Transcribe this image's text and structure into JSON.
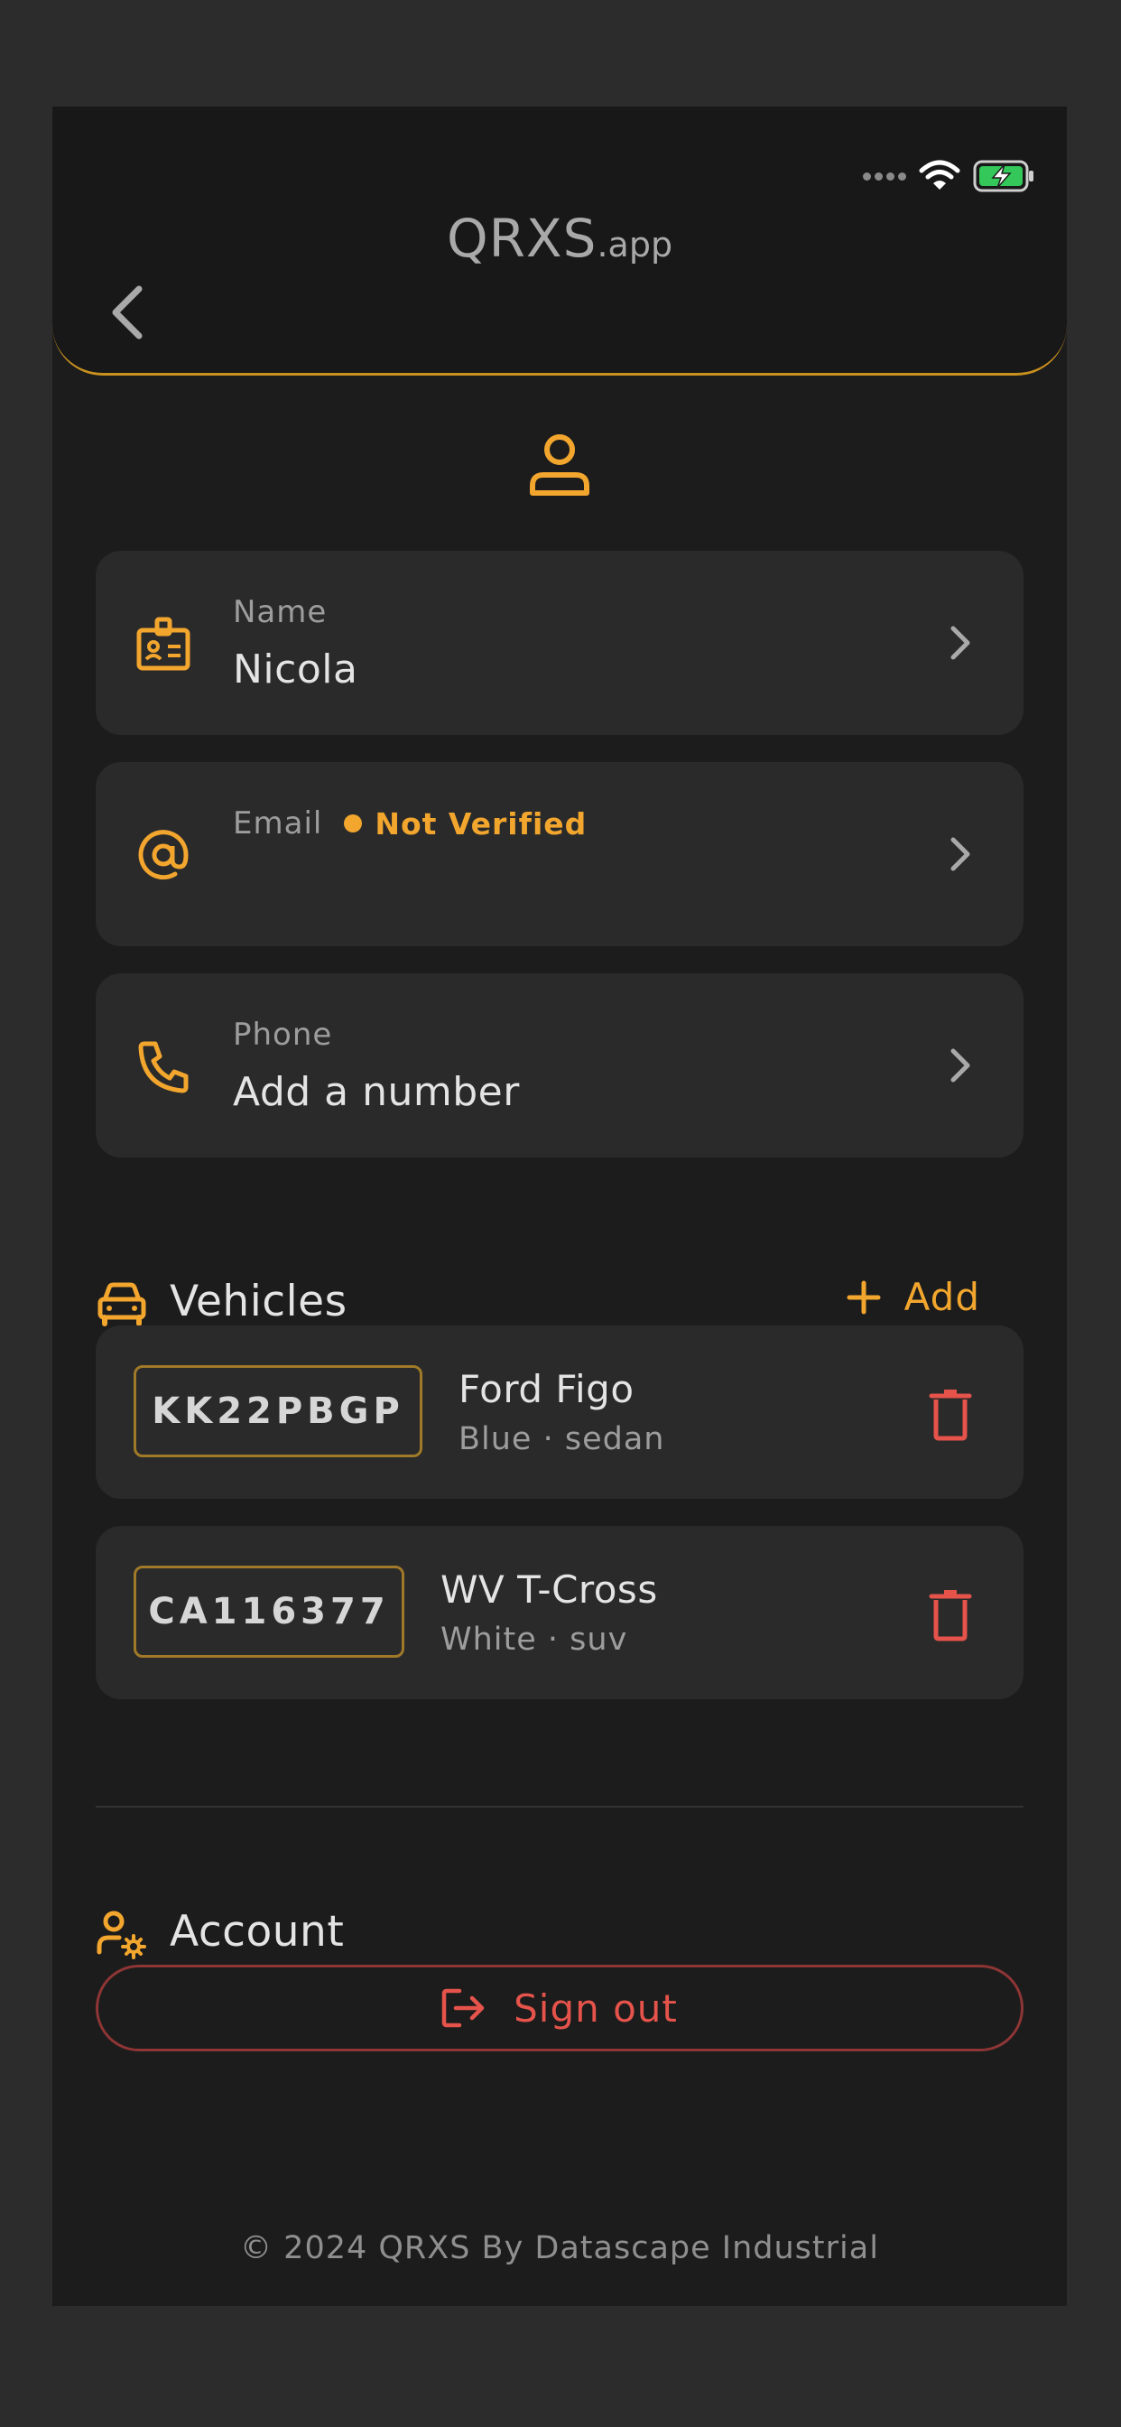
{
  "header": {
    "title_main": "QRXS",
    "title_suffix": ".app"
  },
  "fields": [
    {
      "label": "Name",
      "value": "Nicola",
      "icon": "id-badge-icon"
    },
    {
      "label": "Email",
      "value": "",
      "badge": "Not Verified",
      "icon": "at-sign-icon"
    },
    {
      "label": "Phone",
      "value": "Add a number",
      "icon": "phone-icon"
    }
  ],
  "vehicles": {
    "title": "Vehicles",
    "add_label": "Add",
    "items": [
      {
        "plate": "KK22PBGP",
        "name": "Ford Figo",
        "details": "Blue · sedan"
      },
      {
        "plate": "CA116377",
        "name": "WV T-Cross",
        "details": "White · suv"
      }
    ]
  },
  "account": {
    "title": "Account",
    "signout_label": "Sign out"
  },
  "footer": "© 2024 QRXS By Datascape Industrial",
  "colors": {
    "accent": "#f2a62e",
    "danger": "#e5534b",
    "background": "#1c1c1c",
    "card": "#2a2a2a"
  }
}
